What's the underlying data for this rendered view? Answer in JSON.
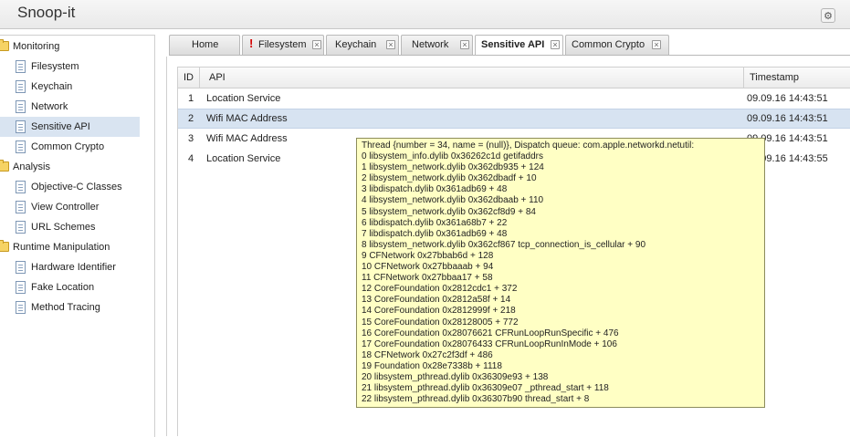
{
  "app": {
    "title": "Snoop-it"
  },
  "sidebar": {
    "groups": [
      {
        "label": "Monitoring",
        "items": [
          {
            "label": "Filesystem"
          },
          {
            "label": "Keychain"
          },
          {
            "label": "Network"
          },
          {
            "label": "Sensitive API",
            "selected": true
          },
          {
            "label": "Common Crypto"
          }
        ]
      },
      {
        "label": "Analysis",
        "items": [
          {
            "label": "Objective-C Classes"
          },
          {
            "label": "View Controller"
          },
          {
            "label": "URL Schemes"
          }
        ]
      },
      {
        "label": "Runtime Manipulation",
        "items": [
          {
            "label": "Hardware Identifier"
          },
          {
            "label": "Fake Location"
          },
          {
            "label": "Method Tracing"
          }
        ]
      }
    ]
  },
  "tabs": [
    {
      "label": "Home",
      "closable": false
    },
    {
      "label": "Filesystem",
      "closable": true,
      "alert": "!"
    },
    {
      "label": "Keychain",
      "closable": true
    },
    {
      "label": "Network",
      "closable": true
    },
    {
      "label": "Sensitive API",
      "closable": true,
      "active": true
    },
    {
      "label": "Common Crypto",
      "closable": true
    }
  ],
  "table": {
    "columns": [
      "ID",
      "API",
      "Timestamp"
    ],
    "rows": [
      {
        "id": "1",
        "api": "Location Service",
        "timestamp": "09.09.16 14:43:51"
      },
      {
        "id": "2",
        "api": "Wifi MAC Address",
        "timestamp": "09.09.16 14:43:51",
        "selected": true
      },
      {
        "id": "3",
        "api": "Wifi MAC Address",
        "timestamp": "09.09.16 14:43:51"
      },
      {
        "id": "4",
        "api": "Location Service",
        "timestamp": "09.09.16 14:43:55"
      }
    ]
  },
  "tooltip": {
    "lines": [
      "Thread {number = 34, name = (null)}, Dispatch queue: com.apple.networkd.netutil:",
      "0 libsystem_info.dylib 0x36262c1d getifaddrs",
      "1 libsystem_network.dylib 0x362db935 + 124",
      "2 libsystem_network.dylib 0x362dbadf + 10",
      "3 libdispatch.dylib 0x361adb69 + 48",
      "4 libsystem_network.dylib 0x362dbaab + 110",
      "5 libsystem_network.dylib 0x362cf8d9 + 84",
      "6 libdispatch.dylib 0x361a68b7 + 22",
      "7 libdispatch.dylib 0x361adb69 + 48",
      "8 libsystem_network.dylib 0x362cf867 tcp_connection_is_cellular + 90",
      "9 CFNetwork 0x27bbab6d + 128",
      "10 CFNetwork 0x27bbaaab + 94",
      "11 CFNetwork 0x27bbaa17 + 58",
      "12 CoreFoundation 0x2812cdc1 + 372",
      "13 CoreFoundation 0x2812a58f + 14",
      "14 CoreFoundation 0x2812999f + 218",
      "15 CoreFoundation 0x28128005 + 772",
      "16 CoreFoundation 0x28076621 CFRunLoopRunSpecific + 476",
      "17 CoreFoundation 0x28076433 CFRunLoopRunInMode + 106",
      "18 CFNetwork 0x27c2f3df + 486",
      "19 Foundation 0x28e7338b + 1118",
      "20 libsystem_pthread.dylib 0x36309e93 + 138",
      "21 libsystem_pthread.dylib 0x36309e07 _pthread_start + 118",
      "22 libsystem_pthread.dylib 0x36307b90 thread_start + 8"
    ]
  },
  "icons": {
    "settings": "gear-icon",
    "group": "folder-icon",
    "item": "document-icon",
    "tab_close": "close-icon",
    "tab_alert": "alert-icon"
  },
  "colors": {
    "selection": "#d9e4f1",
    "tooltip_bg": "#ffffc4",
    "alert": "#d40000",
    "folder": "#f6d364"
  }
}
